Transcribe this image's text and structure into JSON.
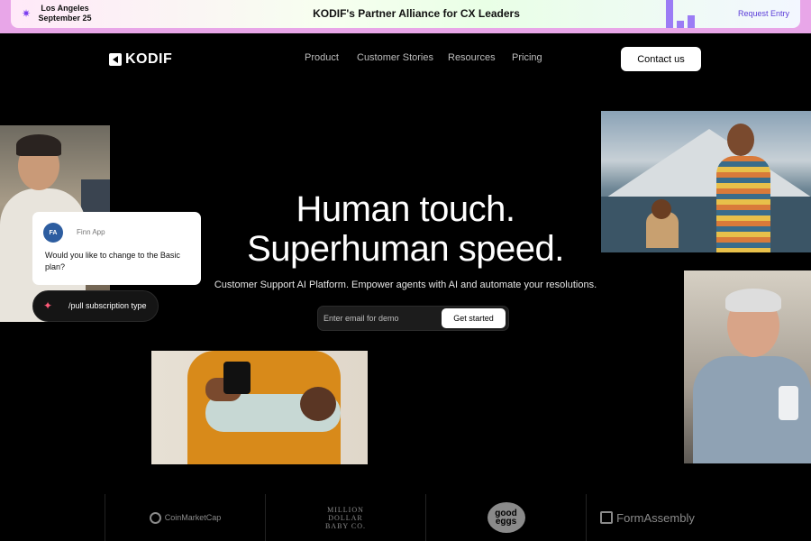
{
  "banner": {
    "location": "Los Angeles",
    "date": "September 25",
    "title": "KODIF's Partner Alliance for CX Leaders",
    "cta": "Request Entry"
  },
  "nav": {
    "brand": "KODIF",
    "links": [
      "Product",
      "Customer Stories",
      "Resources",
      "Pricing"
    ],
    "contact": "Contact us"
  },
  "hero": {
    "heading_line1": "Human touch.",
    "heading_line2": "Superhuman speed.",
    "subheading": "Customer Support AI Platform. Empower agents with AI and automate your resolutions.",
    "email_placeholder": "Enter email for demo",
    "cta": "Get started"
  },
  "chat": {
    "avatar_initials": "FA",
    "app_name": "Finn App",
    "message": "Would you like to change to the Basic plan?",
    "command": "/pull subscription type"
  },
  "logos": {
    "coinmarketcap": "CoinMarketCap",
    "mdb_line1": "MILLION",
    "mdb_line2": "DOLLAR",
    "mdb_line3": "BABY CO.",
    "good_eggs_line1": "good",
    "good_eggs_line2": "eggs",
    "formassembly": "FormAssembly"
  },
  "colors": {
    "background": "#000000",
    "banner_border": "#e8a6e8",
    "accent_purple": "#9b7cf5",
    "button_bg": "#ffffff"
  }
}
